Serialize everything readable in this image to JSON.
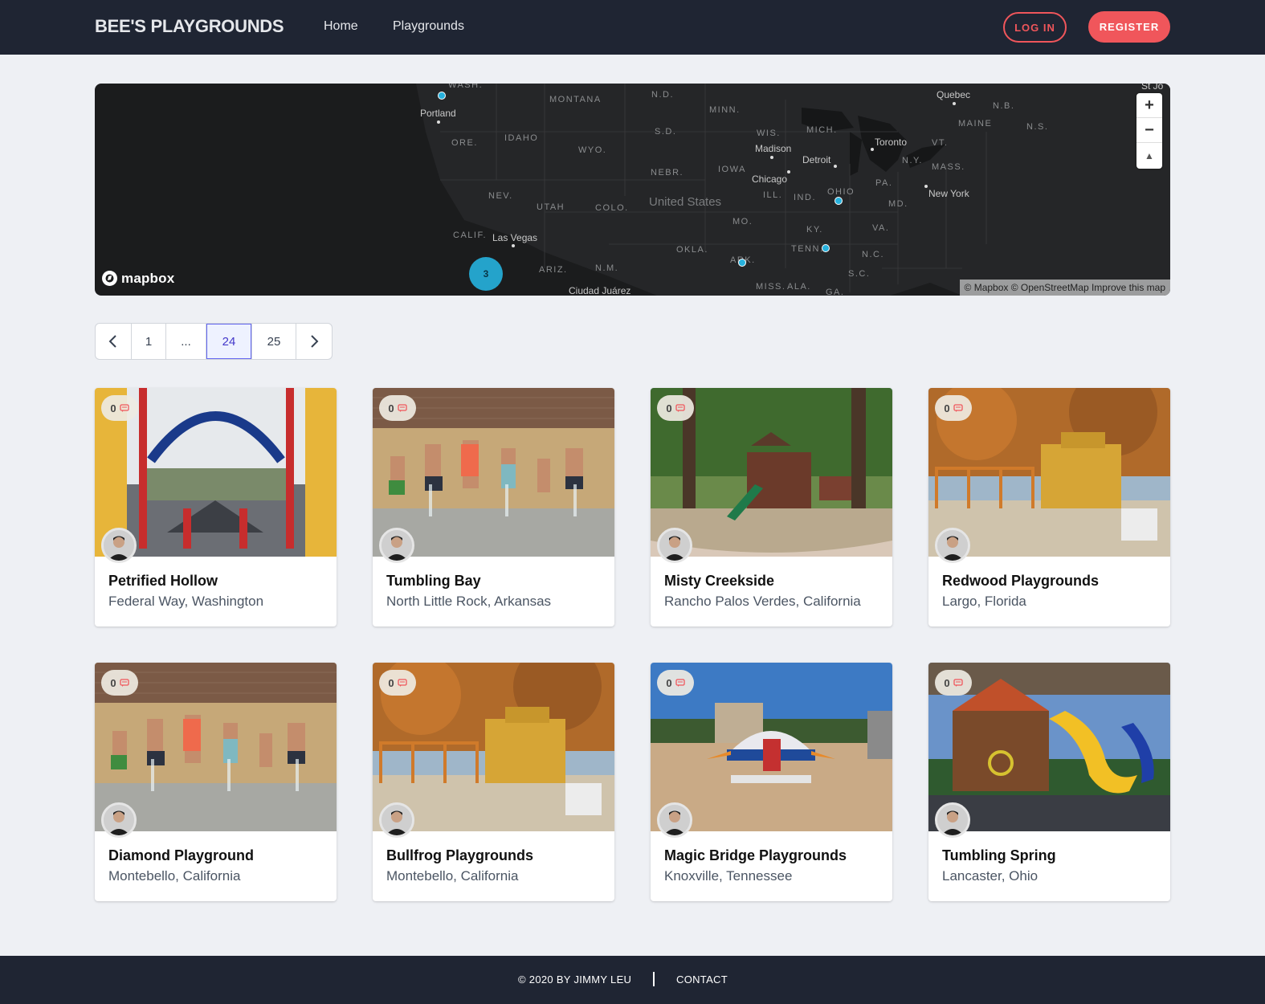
{
  "header": {
    "brand": "BEE'S PLAYGROUNDS",
    "nav": [
      "Home",
      "Playgrounds"
    ],
    "login": "LOG IN",
    "register": "REGISTER"
  },
  "map": {
    "states": [
      "WASH.",
      "MONTANA",
      "N.D.",
      "MINN.",
      "ORE.",
      "IDAHO",
      "WYO.",
      "S.D.",
      "WIS.",
      "MICH.",
      "NEBR.",
      "IOWA",
      "NEV.",
      "UTAH",
      "COLO.",
      "ILL.",
      "IND.",
      "OHIO",
      "PA.",
      "N.Y.",
      "MASS.",
      "MAINE",
      "N.B.",
      "N.S.",
      "VT.",
      "MD.",
      "CALIF.",
      "ARIZ.",
      "N.M.",
      "OKLA.",
      "ARK.",
      "TENN.",
      "KY.",
      "VA.",
      "N.C.",
      "S.C.",
      "MO.",
      "MISS.",
      "ALA.",
      "GA."
    ],
    "cities": [
      "Portland",
      "Quebec",
      "Madison",
      "Detroit",
      "Toronto",
      "Chicago",
      "New York",
      "Las Vegas",
      "Ciudad Juárez",
      "St Jo"
    ],
    "country": "United States",
    "cluster_count": "3",
    "logo": "mapbox",
    "attribution": "© Mapbox © OpenStreetMap Improve this map",
    "zoom_in": "+",
    "zoom_out": "−",
    "compass": "▲"
  },
  "pagination": {
    "prev": "‹",
    "pages": [
      "1",
      "...",
      "24",
      "25"
    ],
    "active": "24",
    "next": "›"
  },
  "playgrounds": [
    {
      "name": "Petrified Hollow",
      "location": "Federal Way, Washington",
      "reviews": "0"
    },
    {
      "name": "Tumbling Bay",
      "location": "North Little Rock, Arkansas",
      "reviews": "0"
    },
    {
      "name": "Misty Creekside",
      "location": "Rancho Palos Verdes, California",
      "reviews": "0"
    },
    {
      "name": "Redwood Playgrounds",
      "location": "Largo, Florida",
      "reviews": "0"
    },
    {
      "name": "Diamond Playground",
      "location": "Montebello, California",
      "reviews": "0"
    },
    {
      "name": "Bullfrog Playgrounds",
      "location": "Montebello, California",
      "reviews": "0"
    },
    {
      "name": "Magic Bridge Playgrounds",
      "location": "Knoxville, Tennessee",
      "reviews": "0"
    },
    {
      "name": "Tumbling Spring",
      "location": "Lancaster, Ohio",
      "reviews": "0"
    }
  ],
  "footer": {
    "copyright": "© 2020 BY JIMMY LEU",
    "contact": "CONTACT"
  },
  "colors": {
    "nav_bg": "#1f2533",
    "accent": "#f0565b",
    "page_bg": "#eef0f4",
    "marker": "#27b1dd",
    "active_page": "#4338ca"
  }
}
